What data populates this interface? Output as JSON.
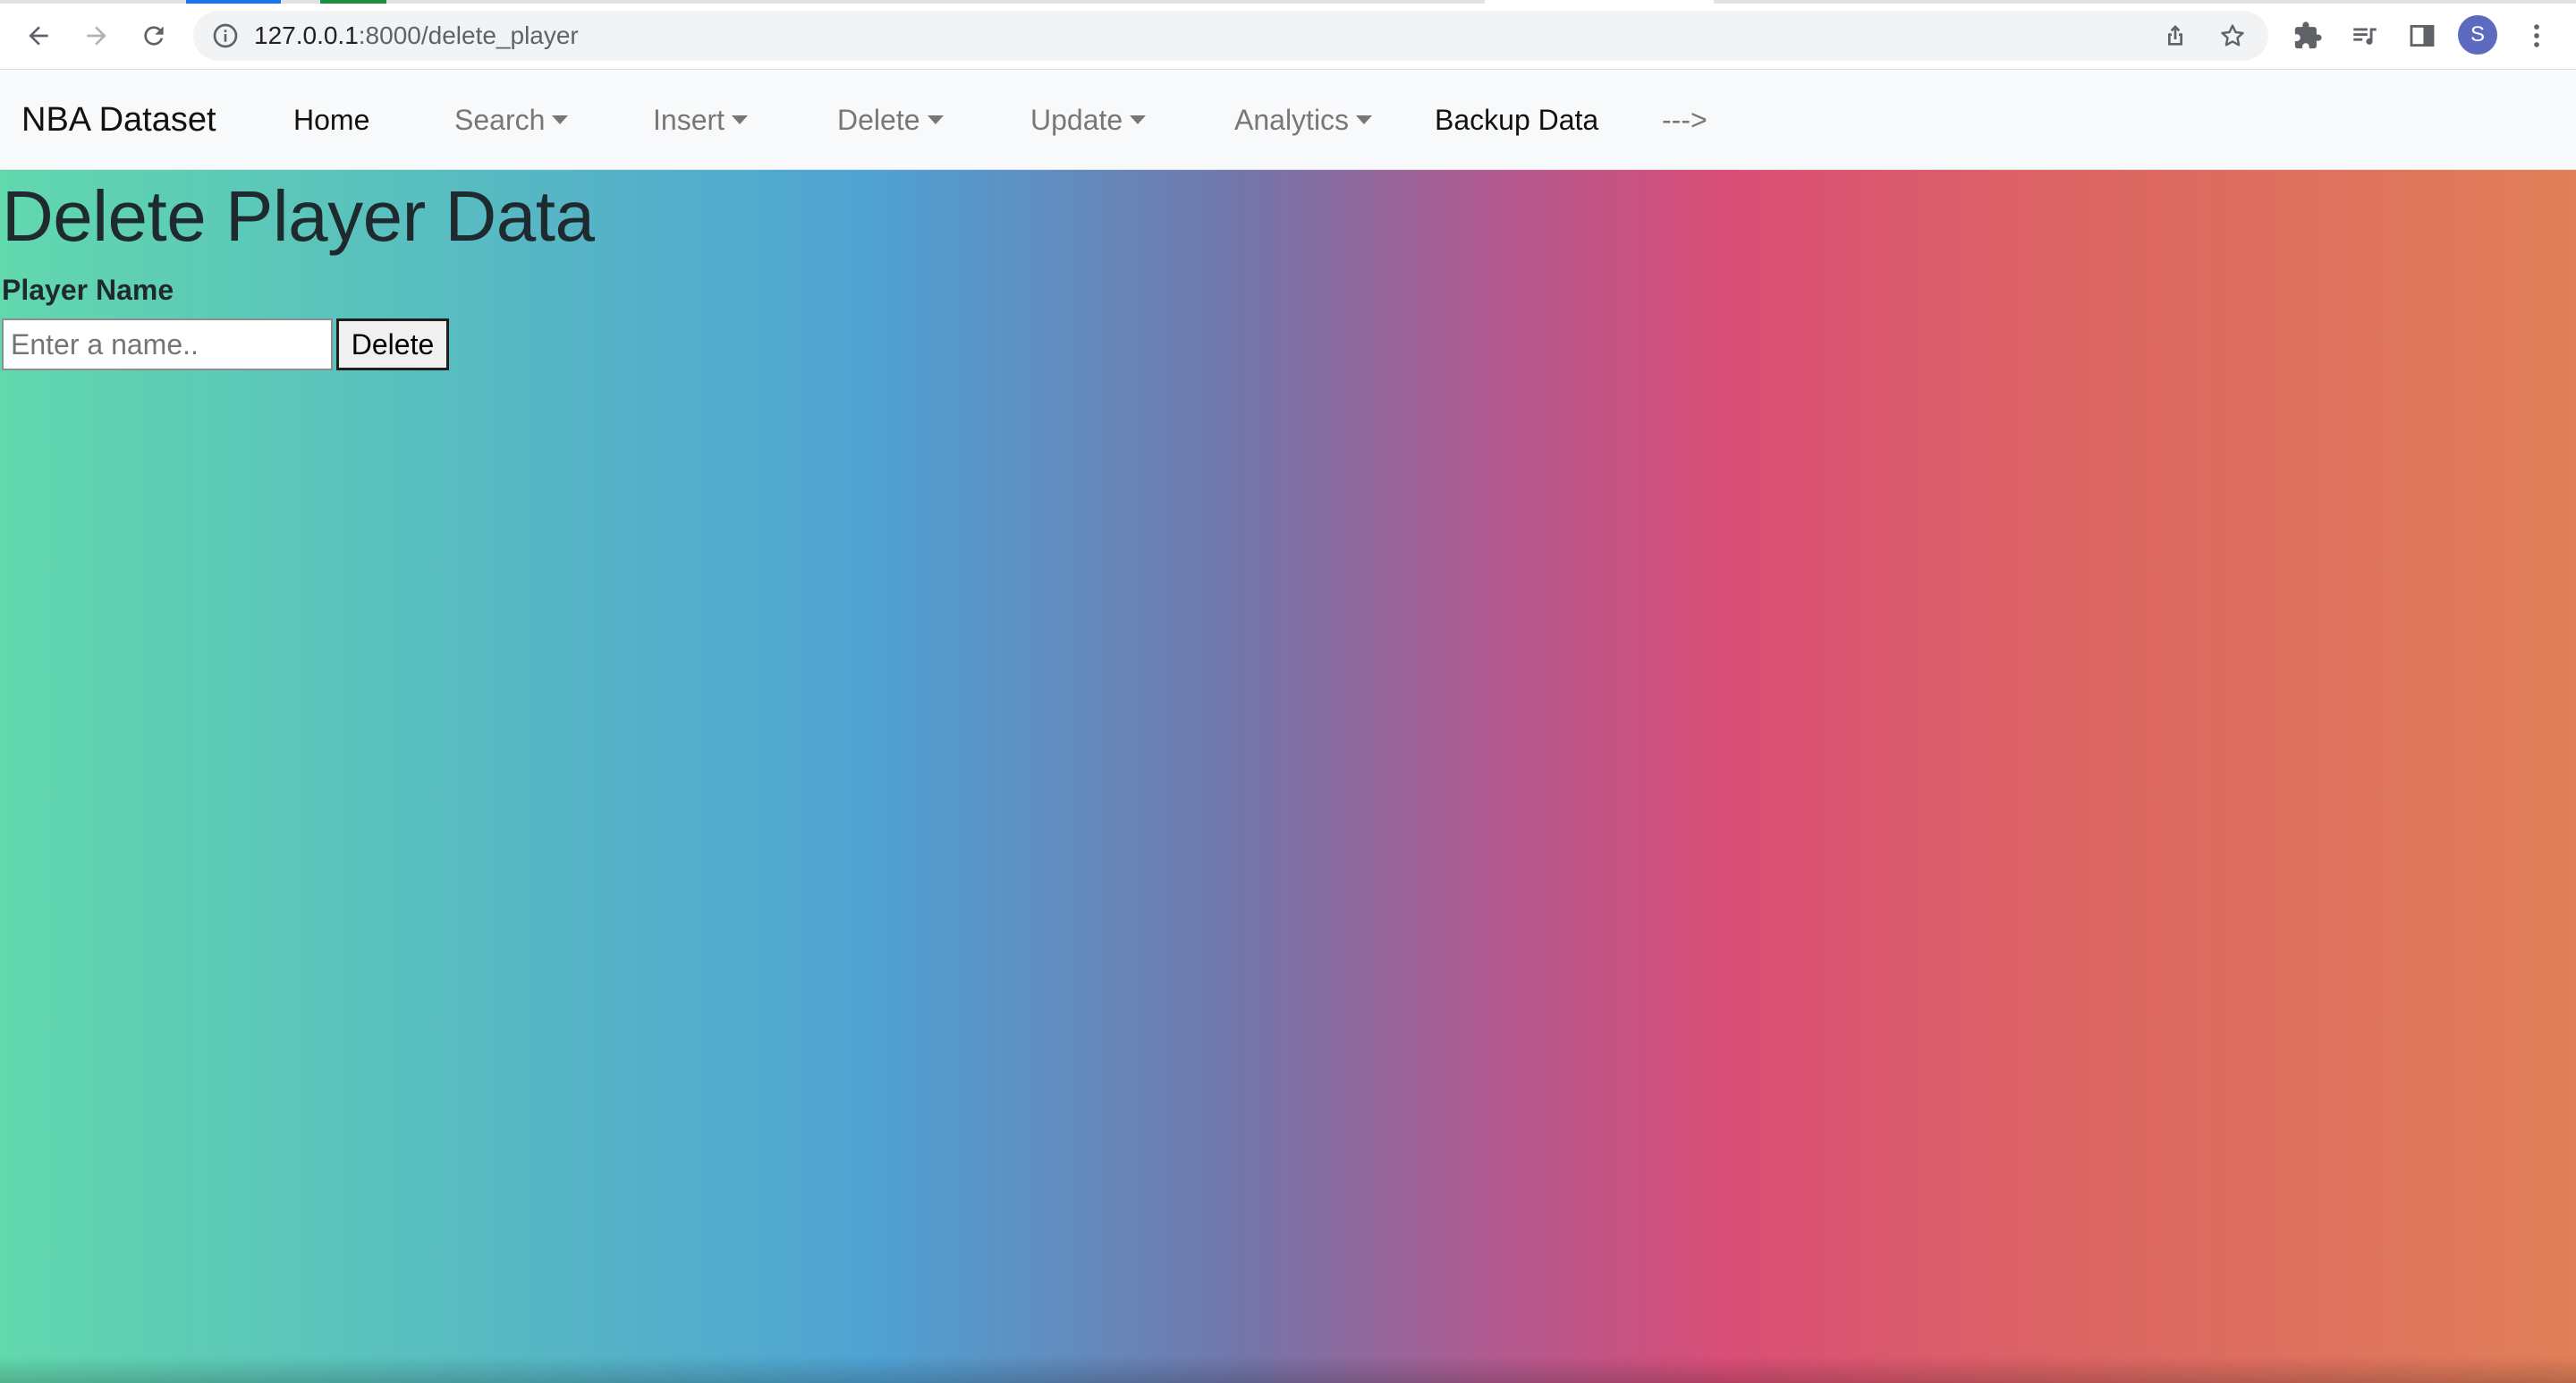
{
  "browser": {
    "url_host": "127.0.0.1",
    "url_path": ":8000/delete_player",
    "profile_initial": "S",
    "icons": {
      "back": "arrow-left-icon",
      "forward": "arrow-right-icon",
      "reload": "reload-icon",
      "site_info": "info-icon",
      "share": "share-icon",
      "bookmark": "star-icon",
      "extensions": "puzzle-icon",
      "media": "media-playlist-icon",
      "side_panel": "side-panel-icon",
      "menu": "kebab-menu-icon"
    }
  },
  "navbar": {
    "brand": "NBA Dataset",
    "links": {
      "home": "Home",
      "search": "Search",
      "insert": "Insert",
      "delete": "Delete",
      "update": "Update",
      "analytics": "Analytics",
      "backup": "Backup Data",
      "arrow": "--->"
    }
  },
  "form": {
    "title": "Delete Player Data",
    "label": "Player Name",
    "input_value": "",
    "input_placeholder": "Enter a name..",
    "submit_label": "Delete"
  },
  "colors": {
    "gradient": [
      "#62d8ad",
      "#4fa2d3",
      "#7277ab",
      "#b25a90",
      "#d94e77",
      "#dc6464",
      "#e07f58"
    ],
    "navbar_bg": "#f8f9fa",
    "avatar": "#5c6bc0"
  }
}
